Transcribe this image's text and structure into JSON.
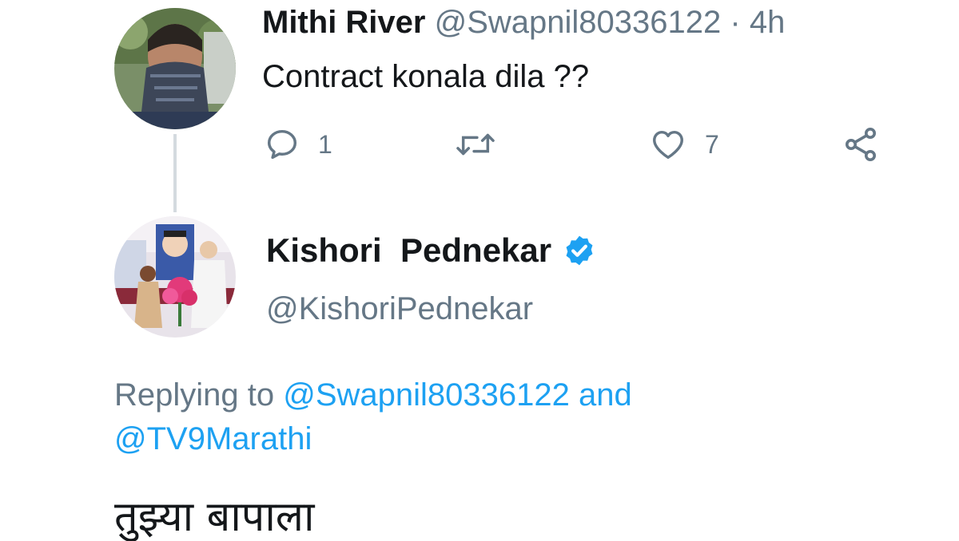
{
  "tweet1": {
    "name": "Mithi River",
    "handle": "@Swapnil80336122",
    "separator": "·",
    "time": "4h",
    "text": "Contract konala dila ??",
    "reply_count": "1",
    "like_count": "7"
  },
  "tweet2": {
    "name": "Kishori  Pednekar",
    "handle": "@KishoriPednekar",
    "replying_prefix": "Replying to",
    "replying_user1": "@Swapnil80336122",
    "replying_and": "and",
    "replying_user2": "@TV9Marathi",
    "text": "तुझ्या बापाला"
  },
  "icons": {
    "reply": "reply-icon",
    "retweet": "retweet-icon",
    "like": "heart-icon",
    "share": "share-icon",
    "verified": "verified-badge-icon"
  },
  "colors": {
    "accent": "#1da1f2",
    "muted": "#657786",
    "text": "#14171a"
  }
}
